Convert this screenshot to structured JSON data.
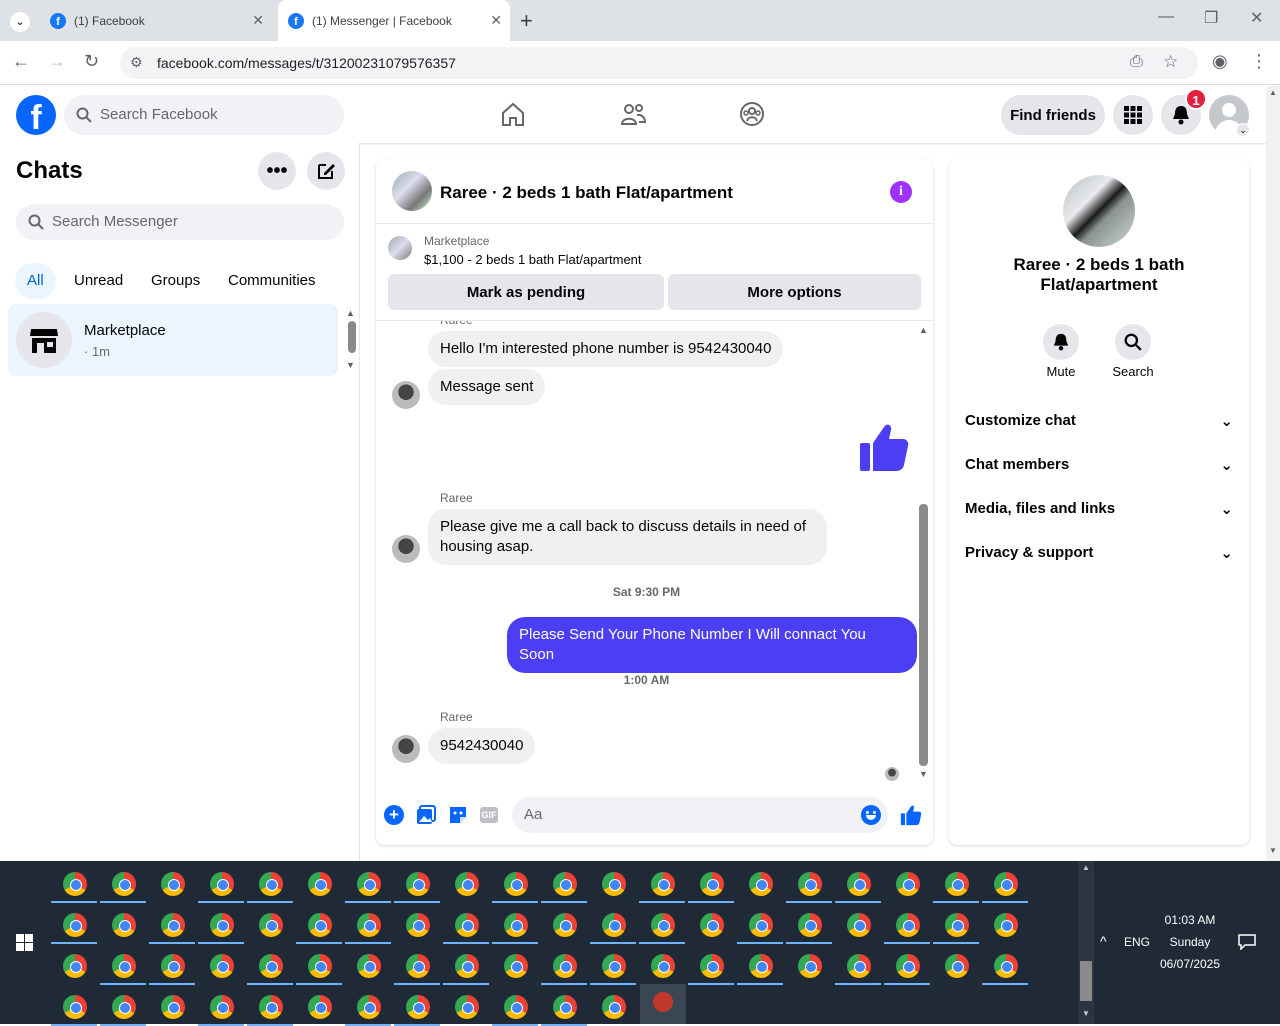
{
  "browser": {
    "tabs": [
      {
        "title": "(1) Facebook"
      },
      {
        "title": "(1) Messenger | Facebook"
      }
    ],
    "url": "facebook.com/messages/t/31200231079576357"
  },
  "header": {
    "search_placeholder": "Search Facebook",
    "find_friends": "Find friends",
    "notification_count": "1"
  },
  "left": {
    "title": "Chats",
    "search_placeholder": "Search Messenger",
    "filters": [
      "All",
      "Unread",
      "Groups",
      "Communities"
    ],
    "conversation": {
      "name": "Marketplace",
      "meta": "· 1m"
    }
  },
  "chat": {
    "title": "Raree · 2 beds 1 bath Flat/apartment",
    "listing_source": "Marketplace",
    "listing_detail": "$1,100 - 2 beds 1 bath Flat/apartment",
    "mark_pending": "Mark as pending",
    "more_options": "More options",
    "messages": {
      "m1": "Hello I'm interested phone number is 9542430040",
      "m2": "Message sent",
      "sender": "Raree",
      "m3": "Please give me a call back to discuss details in need of housing asap.",
      "stamp1": "Sat 9:30 PM",
      "m4": "Please Send Your Phone Number I Will connact You Soon",
      "stamp2": "1:00 AM",
      "m5": "9542430040"
    },
    "composer_placeholder": "Aa"
  },
  "info": {
    "title": "Raree · 2 beds 1 bath Flat/apartment",
    "mute": "Mute",
    "search": "Search",
    "sections": [
      "Customize chat",
      "Chat members",
      "Media, files and links",
      "Privacy & support"
    ]
  },
  "taskbar": {
    "time": "01:03 AM",
    "day": "Sunday",
    "date": "06/07/2025",
    "lang": "ENG"
  },
  "colors": {
    "fb_blue": "#0866ff",
    "bubble_mine": "#4c3ef2",
    "accent_purple": "#a033ff"
  }
}
